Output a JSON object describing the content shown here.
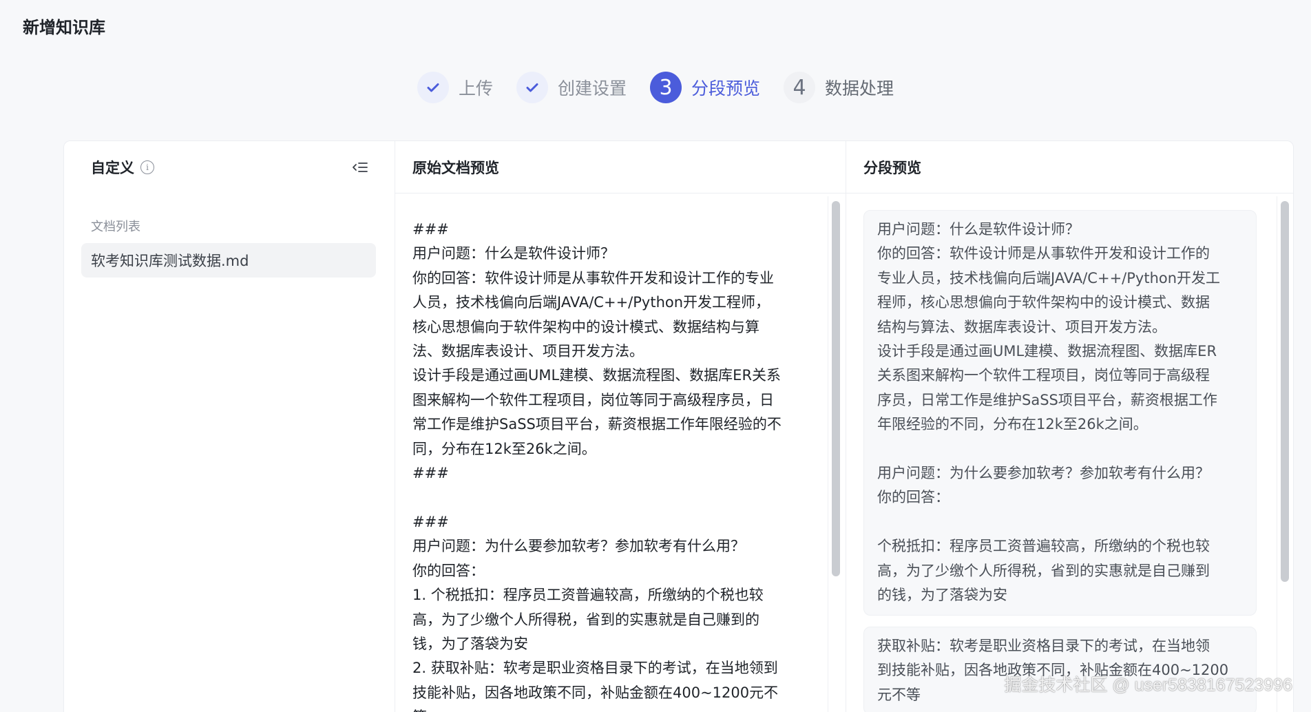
{
  "page": {
    "title": "新增知识库"
  },
  "steps": [
    {
      "label": "上传",
      "state": "done",
      "icon": "check-icon"
    },
    {
      "label": "创建设置",
      "state": "done",
      "icon": "check-icon"
    },
    {
      "number": "3",
      "label": "分段预览",
      "state": "active"
    },
    {
      "number": "4",
      "label": "数据处理",
      "state": "todo"
    }
  ],
  "left_panel": {
    "title": "自定义",
    "doc_list_label": "文档列表",
    "documents": [
      "软考知识库测试数据.md"
    ]
  },
  "raw_preview": {
    "title": "原始文档预览",
    "lines": [
      "###",
      "用户问题：什么是软件设计师？",
      "你的回答：软件设计师是从事软件开发和设计工作的专业",
      "人员，技术栈偏向后端JAVA/C++/Python开发工程师，",
      "核心思想偏向于软件架构中的设计模式、数据结构与算",
      "法、数据库表设计、项目开发方法。",
      "设计手段是通过画UML建模、数据流程图、数据库ER关系",
      "图来解构一个软件工程项目，岗位等同于高级程序员，日",
      "常工作是维护SaSS项目平台，薪资根据工作年限经验的不",
      "同，分布在12k至26k之间。",
      "###",
      "",
      "###",
      "用户问题：为什么要参加软考？参加软考有什么用？",
      "你的回答：",
      "1. 个税抵扣：程序员工资普遍较高，所缴纳的个税也较",
      "高，为了少缴个人所得税，省到的实惠就是自己赚到的",
      "钱，为了落袋为安",
      "2. 获取补贴：软考是职业资格目录下的考试，在当地领到",
      "技能补贴，因各地政策不同，补贴金额在400~1200元不",
      "等"
    ]
  },
  "segment_preview": {
    "title": "分段预览",
    "segments": [
      {
        "lines": [
          "用户问题：什么是软件设计师？",
          "你的回答：软件设计师是从事软件开发和设计工作的",
          "专业人员，技术栈偏向后端JAVA/C++/Python开发工",
          "程师，核心思想偏向于软件架构中的设计模式、数据",
          "结构与算法、数据库表设计、项目开发方法。",
          "设计手段是通过画UML建模、数据流程图、数据库ER",
          "关系图来解构一个软件工程项目，岗位等同于高级程",
          "序员，日常工作是维护SaSS项目平台，薪资根据工作",
          "年限经验的不同，分布在12k至26k之间。",
          "",
          "用户问题：为什么要参加软考？参加软考有什么用？",
          "你的回答：",
          "",
          "个税抵扣：程序员工资普遍较高，所缴纳的个税也较",
          "高，为了少缴个人所得税，省到的实惠就是自己赚到",
          "的钱，为了落袋为安"
        ]
      },
      {
        "lines": [
          "获取补贴：软考是职业资格目录下的考试，在当地领",
          "到技能补贴，因各地政策不同，补贴金额在400~1200",
          "元不等"
        ]
      }
    ]
  },
  "watermark": "掘金技术社区 @ user5838167523996"
}
